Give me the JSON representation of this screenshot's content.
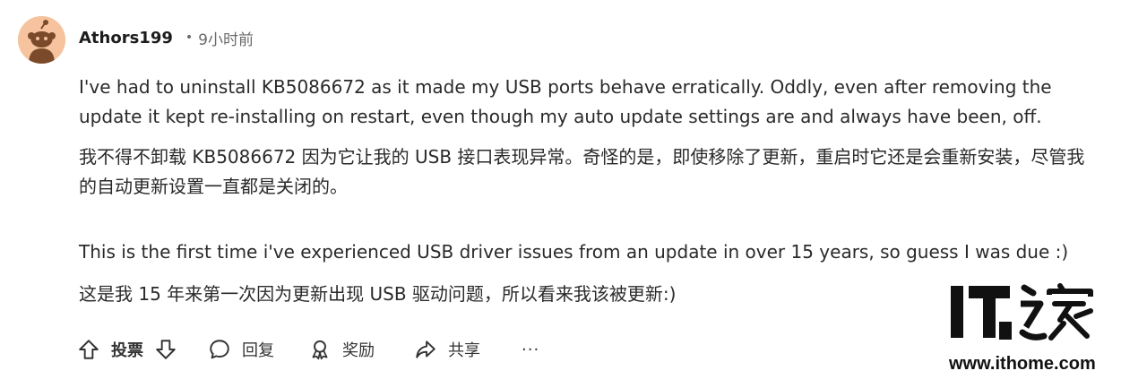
{
  "comment": {
    "author": "Athors199",
    "separator": "•",
    "timestamp": "9小时前",
    "paragraphs": [
      "I've had to uninstall KB5086672 as it made my USB ports behave erratically. Oddly, even after removing the update it kept re-installing on restart, even though my auto update settings are and always have been, off.",
      "我不得不卸载 KB5086672 因为它让我的 USB 接口表现异常。奇怪的是，即使移除了更新，重启时它还是会重新安装，尽管我的自动更新设置一直都是关闭的。",
      "This is the first time i've experienced USB driver issues from an update in over 15 years, so guess I was due :)",
      "这是我 15 年来第一次因为更新出现 USB 驱动问题，所以看来我该被更新:)"
    ]
  },
  "actions": {
    "vote_label": "投票",
    "reply_label": "回复",
    "award_label": "奖励",
    "share_label": "共享",
    "more_label": "···"
  },
  "watermark": {
    "logo_text": "IT之家",
    "url": "www.ithome.com"
  },
  "colors": {
    "avatar_bg": "#f6c39e",
    "text": "#2a2a2a",
    "muted": "#6a6a6a"
  }
}
